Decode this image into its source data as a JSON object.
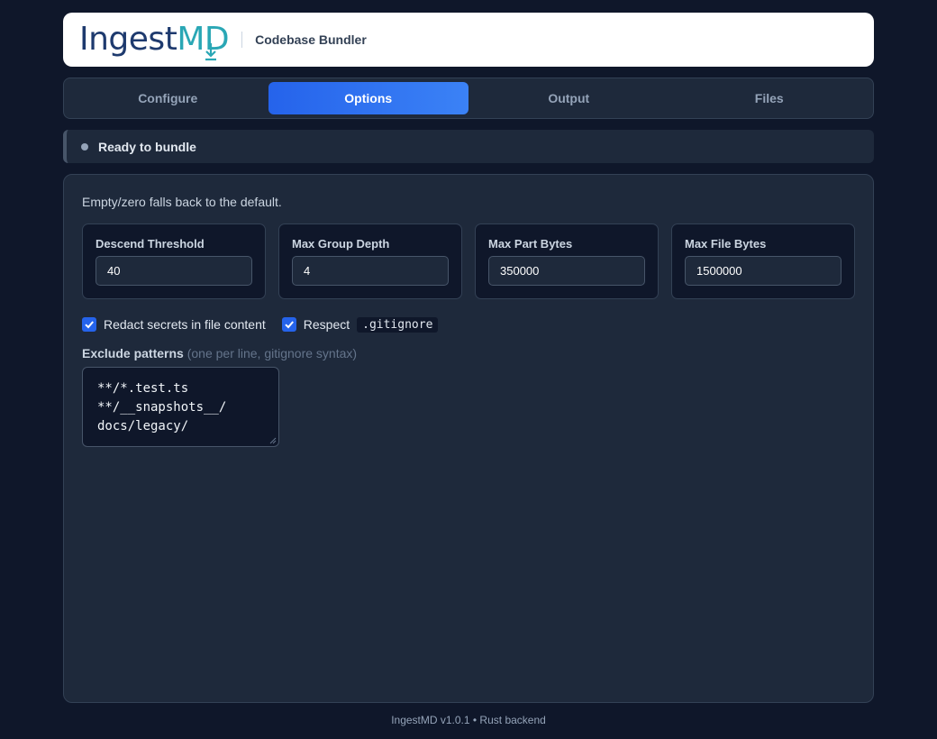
{
  "header": {
    "logo_ingest": "Ingest",
    "logo_md": "MD",
    "subtitle": "Codebase Bundler"
  },
  "tabs": [
    {
      "label": "Configure",
      "active": false
    },
    {
      "label": "Options",
      "active": true
    },
    {
      "label": "Output",
      "active": false
    },
    {
      "label": "Files",
      "active": false
    }
  ],
  "status": {
    "text": "Ready to bundle"
  },
  "options": {
    "hint": "Empty/zero falls back to the default.",
    "fields": [
      {
        "label": "Descend Threshold",
        "value": "40"
      },
      {
        "label": "Max Group Depth",
        "value": "4"
      },
      {
        "label": "Max Part Bytes",
        "value": "350000"
      },
      {
        "label": "Max File Bytes",
        "value": "1500000"
      }
    ],
    "redact": {
      "label": "Redact secrets in file content",
      "checked": true
    },
    "respect": {
      "label": "Respect",
      "code": ".gitignore",
      "checked": true
    },
    "exclude": {
      "label": "Exclude patterns",
      "hint": "(one per line, gitignore syntax)",
      "lines": [
        "**/*.test.ts",
        "**/__snapshots__/",
        "docs/legacy/"
      ]
    }
  },
  "footer": {
    "text": "IngestMD v1.0.1 • Rust backend"
  },
  "colors": {
    "background": "#0f172a",
    "panel": "#1e293b",
    "accent": "#2563eb",
    "logo_navy": "#1e3a6e",
    "logo_teal": "#2aa7b5"
  }
}
